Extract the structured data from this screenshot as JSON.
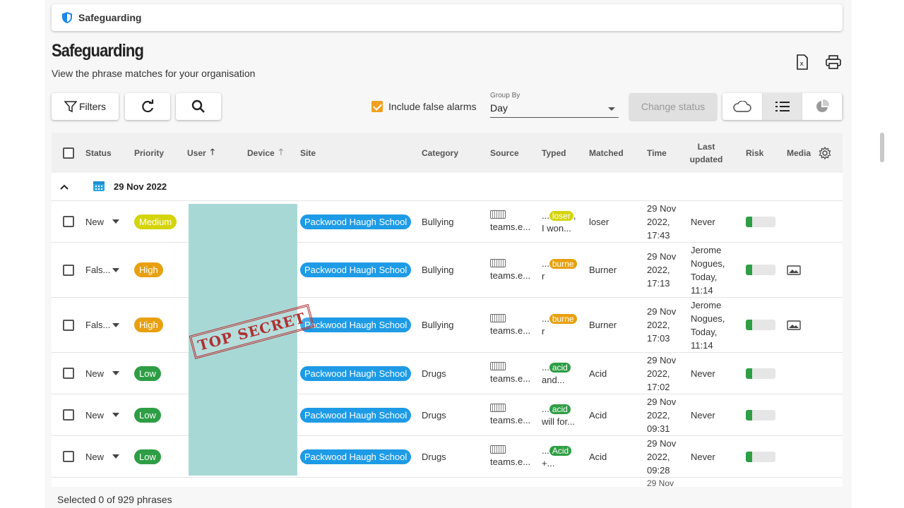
{
  "breadcrumb": {
    "label": "Safeguarding",
    "icon": "shield-icon"
  },
  "page": {
    "title": "Safeguarding",
    "subtitle": "View the phrase matches for your organisation"
  },
  "toolbar": {
    "filters_label": "Filters",
    "include_false_alarms_label": "Include false alarms",
    "include_false_alarms_checked": true,
    "group_by_label": "Group By",
    "group_by_value": "Day",
    "change_status_label": "Change status"
  },
  "columns": {
    "status": "Status",
    "priority": "Priority",
    "user": "User",
    "device": "Device",
    "site": "Site",
    "category": "Category",
    "source": "Source",
    "typed": "Typed",
    "matched": "Matched",
    "time": "Time",
    "last_updated": "Last updated",
    "risk": "Risk",
    "media": "Media"
  },
  "group_date": "29 Nov 2022",
  "rows": [
    {
      "status": "New",
      "priority": "Medium",
      "priority_color": "#d4d40a",
      "site": "Packwood Haugh School",
      "category": "Bullying",
      "source": "teams.e...",
      "typed_tag": "loser",
      "typed_prefix": "...",
      "typed_suffix": ",",
      "typed_line2": "I won...",
      "tag_color": "#d4d40a",
      "matched": "loser",
      "time_l1": "29 Nov",
      "time_l2": "2022,",
      "time_l3": "17:43",
      "updated": "Never",
      "media": false
    },
    {
      "status": "Fals...",
      "priority": "High",
      "priority_color": "#e8a010",
      "site": "Packwood Haugh School",
      "category": "Bullying",
      "source": "teams.e...",
      "typed_tag": "burne",
      "typed_prefix": "...",
      "typed_suffix": "",
      "typed_line2": "r",
      "tag_color": "#e8a010",
      "matched": "Burner",
      "time_l1": "29 Nov",
      "time_l2": "2022,",
      "time_l3": "17:13",
      "updated": "Jerome Nogues, Today, 11:14",
      "media": true
    },
    {
      "status": "Fals...",
      "priority": "High",
      "priority_color": "#e8a010",
      "site": "Packwood Haugh School",
      "category": "Bullying",
      "source": "teams.e...",
      "typed_tag": "burne",
      "typed_prefix": "...",
      "typed_suffix": "",
      "typed_line2": "r",
      "tag_color": "#e8a010",
      "matched": "Burner",
      "time_l1": "29 Nov",
      "time_l2": "2022,",
      "time_l3": "17:03",
      "updated": "Jerome Nogues, Today, 11:14",
      "media": true
    },
    {
      "status": "New",
      "priority": "Low",
      "priority_color": "#2e9e44",
      "site": "Packwood Haugh School",
      "category": "Drugs",
      "source": "teams.e...",
      "typed_tag": "acid",
      "typed_prefix": "...",
      "typed_suffix": "",
      "typed_line2": "and...",
      "tag_color": "#2e9e44",
      "matched": "Acid",
      "time_l1": "29 Nov",
      "time_l2": "2022,",
      "time_l3": "17:02",
      "updated": "Never",
      "media": false
    },
    {
      "status": "New",
      "priority": "Low",
      "priority_color": "#2e9e44",
      "site": "Packwood Haugh School",
      "category": "Drugs",
      "source": "teams.e...",
      "typed_tag": "acid",
      "typed_prefix": "...",
      "typed_suffix": "",
      "typed_line2": "will for...",
      "tag_color": "#2e9e44",
      "matched": "Acid",
      "time_l1": "29 Nov",
      "time_l2": "2022,",
      "time_l3": "09:31",
      "updated": "Never",
      "media": false
    },
    {
      "status": "New",
      "priority": "Low",
      "priority_color": "#2e9e44",
      "site": "Packwood Haugh School",
      "category": "Drugs",
      "source": "teams.e...",
      "typed_tag": "Acid",
      "typed_prefix": "...",
      "typed_suffix": "",
      "typed_line2": "+...",
      "tag_color": "#2e9e44",
      "matched": "Acid",
      "time_l1": "29 Nov",
      "time_l2": "2022,",
      "time_l3": "09:28",
      "updated": "Never",
      "media": false
    }
  ],
  "partial_row_time": "29 Nov",
  "stamp_text": "TOP SECRET",
  "footer": "Selected 0 of 929 phrases"
}
